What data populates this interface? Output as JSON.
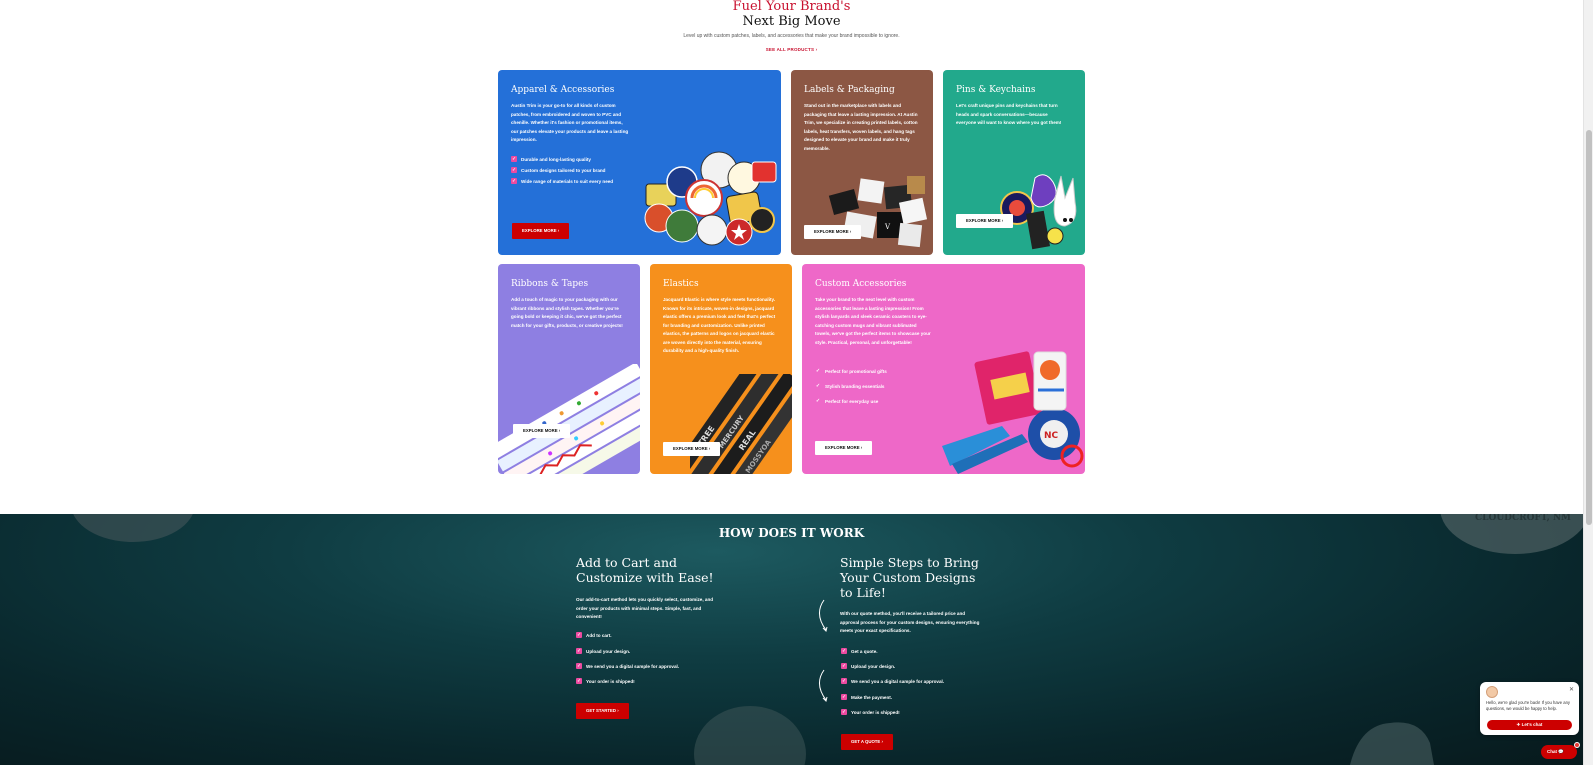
{
  "hero": {
    "title_line1": "Fuel Your Brand's",
    "title_line2": "Next Big Move",
    "subtitle": "Level up with custom patches, labels, and accessories that make your brand impossible to ignore.",
    "see_all": "SEE ALL PRODUCTS ›"
  },
  "cards": {
    "apparel": {
      "title": "Apparel & Accessories",
      "desc": "Austin Trim is your go-to for all kinds of custom patches, from embroidered and woven to PVC and chenille. Whether it's fashion or promotional items, our patches elevate your products and leave a lasting impression.",
      "bullets": [
        "Durable and long-lasting quality",
        "Custom designs tailored to your brand",
        "Wide range of materials to suit every need"
      ],
      "button": "EXPLORE MORE ›",
      "color": "#2470d8"
    },
    "labels": {
      "title": "Labels & Packaging",
      "desc": "Stand out in the marketplace with labels and packaging that leave a lasting impression. At Austin Trim, we specialize in creating printed labels, cotton labels, heat transfers, woven labels, and hang tags designed to elevate your brand and make it truly memorable.",
      "button": "EXPLORE MORE ›",
      "color": "#8c5744"
    },
    "pins": {
      "title": "Pins & Keychains",
      "desc": "Let's craft unique pins and keychains that turn heads and spark conversations—because everyone will want to know where you got them!",
      "button": "EXPLORE MORE ›",
      "color": "#22a98c"
    },
    "ribbons": {
      "title": "Ribbons & Tapes",
      "desc": "Add a touch of magic to your packaging with our vibrant ribbons and stylish tapes. Whether you're going bold or keeping it chic, we've got the perfect match for your gifts, products, or creative projects!",
      "button": "EXPLORE MORE ›",
      "color": "#8e7fe2"
    },
    "elastics": {
      "title": "Elastics",
      "desc": "Jacquard Elastic is where style meets functionality. Known for its intricate, woven-in designs, jacquard elastic offers a premium look and feel that's perfect for branding and customization. Unlike printed elastics, the patterns and logos on jacquard elastic are woven directly into the material, ensuring durability and a high-quality finish.",
      "button": "EXPLORE MORE ›",
      "color": "#f6901c"
    },
    "custom": {
      "title": "Custom Accessories",
      "desc": "Take your brand to the next level with custom accessories that leave a lasting impression! From stylish lanyards and sleek ceramic coasters to eye-catching custom mugs and vibrant sublimated towels, we've got the perfect items to showcase your style. Practical, personal, and unforgettable!",
      "bullets": [
        "Perfect for promotional gifts",
        "Stylish branding essentials",
        "Perfect for everyday use"
      ],
      "button": "EXPLORE MORE ›",
      "color": "#ee68c8"
    }
  },
  "how": {
    "title": "HOW DOES IT WORK",
    "cart": {
      "heading": "Add to Cart and Customize with Ease!",
      "desc": "Our add-to-cart method lets you quickly select, customize, and order your products with minimal steps. Simple, fast, and convenient!",
      "steps": [
        "Add to cart.",
        "Upload your design.",
        "We send you a digital sample for approval.",
        "Your order is shipped!"
      ],
      "button": "GET STARTED ›"
    },
    "quote": {
      "heading": "Simple Steps to Bring Your Custom Designs to Life!",
      "desc": "With our quote method, you'll receive a tailored price and approval process for your custom designs, ensuring everything meets your exact specifications.",
      "steps": [
        "Get a quote.",
        "Upload your design.",
        "We send you a digital sample for approval.",
        "Make the payment.",
        "Your order is shipped!"
      ],
      "button": "GET A QUOTE ›"
    }
  },
  "chat": {
    "message": "Hello, we're glad you're back! If you have any questions, we would be happy to help.",
    "button": "✈ Let's chat",
    "launcher": "Chat"
  }
}
